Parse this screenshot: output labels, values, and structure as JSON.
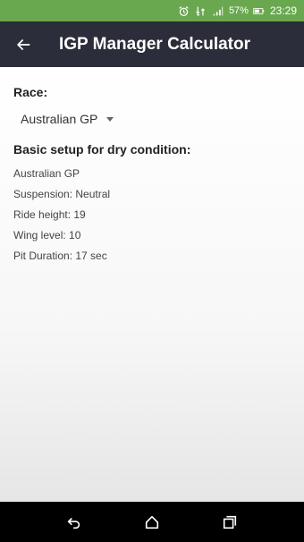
{
  "status_bar": {
    "battery": "57%",
    "time": "23:29",
    "icons": [
      "alarm-icon",
      "data-transfer-icon",
      "signal-icon",
      "battery-icon"
    ]
  },
  "app_bar": {
    "title": "IGP Manager Calculator",
    "back_icon": "back-arrow-icon"
  },
  "form": {
    "race_label": "Race:",
    "race_selected": "Australian GP"
  },
  "setup": {
    "title": "Basic setup for dry condition:",
    "lines": [
      "Australian GP",
      "Suspension: Neutral",
      "Ride height: 19",
      "Wing level: 10",
      "Pit Duration: 17 sec"
    ]
  },
  "nav": {
    "icons": [
      "back-icon",
      "home-icon",
      "recents-icon"
    ]
  },
  "colors": {
    "status_bar": "#6aa84f",
    "app_bar": "#2b2d3a",
    "nav_bar": "#000000"
  }
}
